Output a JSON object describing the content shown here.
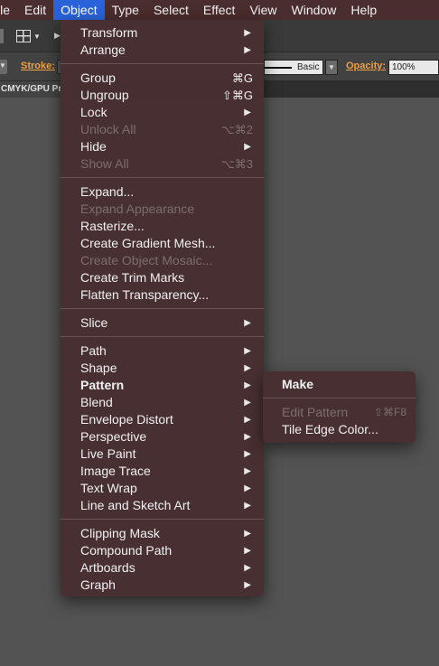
{
  "menubar": {
    "items": [
      "ile",
      "Edit",
      "Object",
      "Type",
      "Select",
      "Effect",
      "View",
      "Window",
      "Help"
    ],
    "active": "Object"
  },
  "control_bar": {
    "stroke_label": "Stroke:",
    "stroke_style": "Basic",
    "opacity_label": "Opacity:",
    "opacity_value": "100%"
  },
  "doc_tab": {
    "label": "CMYK/GPU Pr"
  },
  "object_menu": {
    "items": [
      {
        "label": "Transform",
        "submenu": true
      },
      {
        "label": "Arrange",
        "submenu": true
      },
      {
        "label": "Group",
        "shortcut": "⌘G"
      },
      {
        "label": "Ungroup",
        "shortcut": "⇧⌘G"
      },
      {
        "label": "Lock",
        "submenu": true
      },
      {
        "label": "Unlock All",
        "shortcut": "⌥⌘2",
        "disabled": true
      },
      {
        "label": "Hide",
        "submenu": true
      },
      {
        "label": "Show All",
        "shortcut": "⌥⌘3",
        "disabled": true
      },
      {
        "label": "Expand..."
      },
      {
        "label": "Expand Appearance",
        "disabled": true
      },
      {
        "label": "Rasterize..."
      },
      {
        "label": "Create Gradient Mesh..."
      },
      {
        "label": "Create Object Mosaic...",
        "disabled": true
      },
      {
        "label": "Create Trim Marks"
      },
      {
        "label": "Flatten Transparency..."
      },
      {
        "label": "Slice",
        "submenu": true
      },
      {
        "label": "Path",
        "submenu": true
      },
      {
        "label": "Shape",
        "submenu": true
      },
      {
        "label": "Pattern",
        "submenu": true,
        "highlighted": true
      },
      {
        "label": "Blend",
        "submenu": true
      },
      {
        "label": "Envelope Distort",
        "submenu": true
      },
      {
        "label": "Perspective",
        "submenu": true
      },
      {
        "label": "Live Paint",
        "submenu": true
      },
      {
        "label": "Image Trace",
        "submenu": true
      },
      {
        "label": "Text Wrap",
        "submenu": true
      },
      {
        "label": "Line and Sketch Art",
        "submenu": true
      },
      {
        "label": "Clipping Mask",
        "submenu": true
      },
      {
        "label": "Compound Path",
        "submenu": true
      },
      {
        "label": "Artboards",
        "submenu": true
      },
      {
        "label": "Graph",
        "submenu": true
      }
    ]
  },
  "pattern_submenu": {
    "items": [
      {
        "label": "Make",
        "bold": true
      },
      {
        "label": "Edit Pattern",
        "shortcut": "⇧⌘F8",
        "disabled": true
      },
      {
        "label": "Tile Edge Color..."
      }
    ]
  },
  "icons": {
    "submenu_arrow": "▶",
    "dropdown_arrow": "▼"
  },
  "colors": {
    "menubar_bg": "#4a2d2e",
    "active_menu": "#2a63d9",
    "menu_bg": "#483032",
    "disabled_text": "#7e6c6d",
    "accent_label": "#f0a040",
    "canvas_bg": "#535353"
  }
}
